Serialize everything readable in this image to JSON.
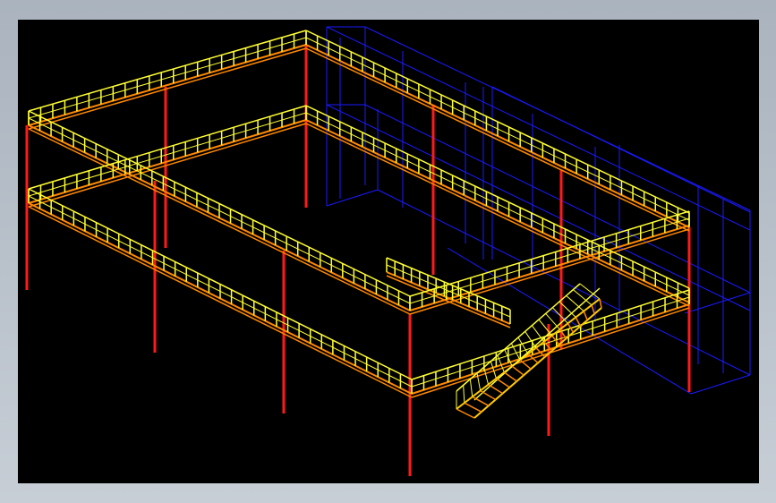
{
  "scene": {
    "description_type": "cad-3d-wireframe",
    "background": "#000000",
    "frame_background": "#b8c0ca",
    "colors": {
      "columns": "#ff1a1a",
      "railing": "#ffff33",
      "deck": "#ff8800",
      "envelope": "#1a1aff",
      "stair_stringer": "#ffcc00"
    }
  }
}
